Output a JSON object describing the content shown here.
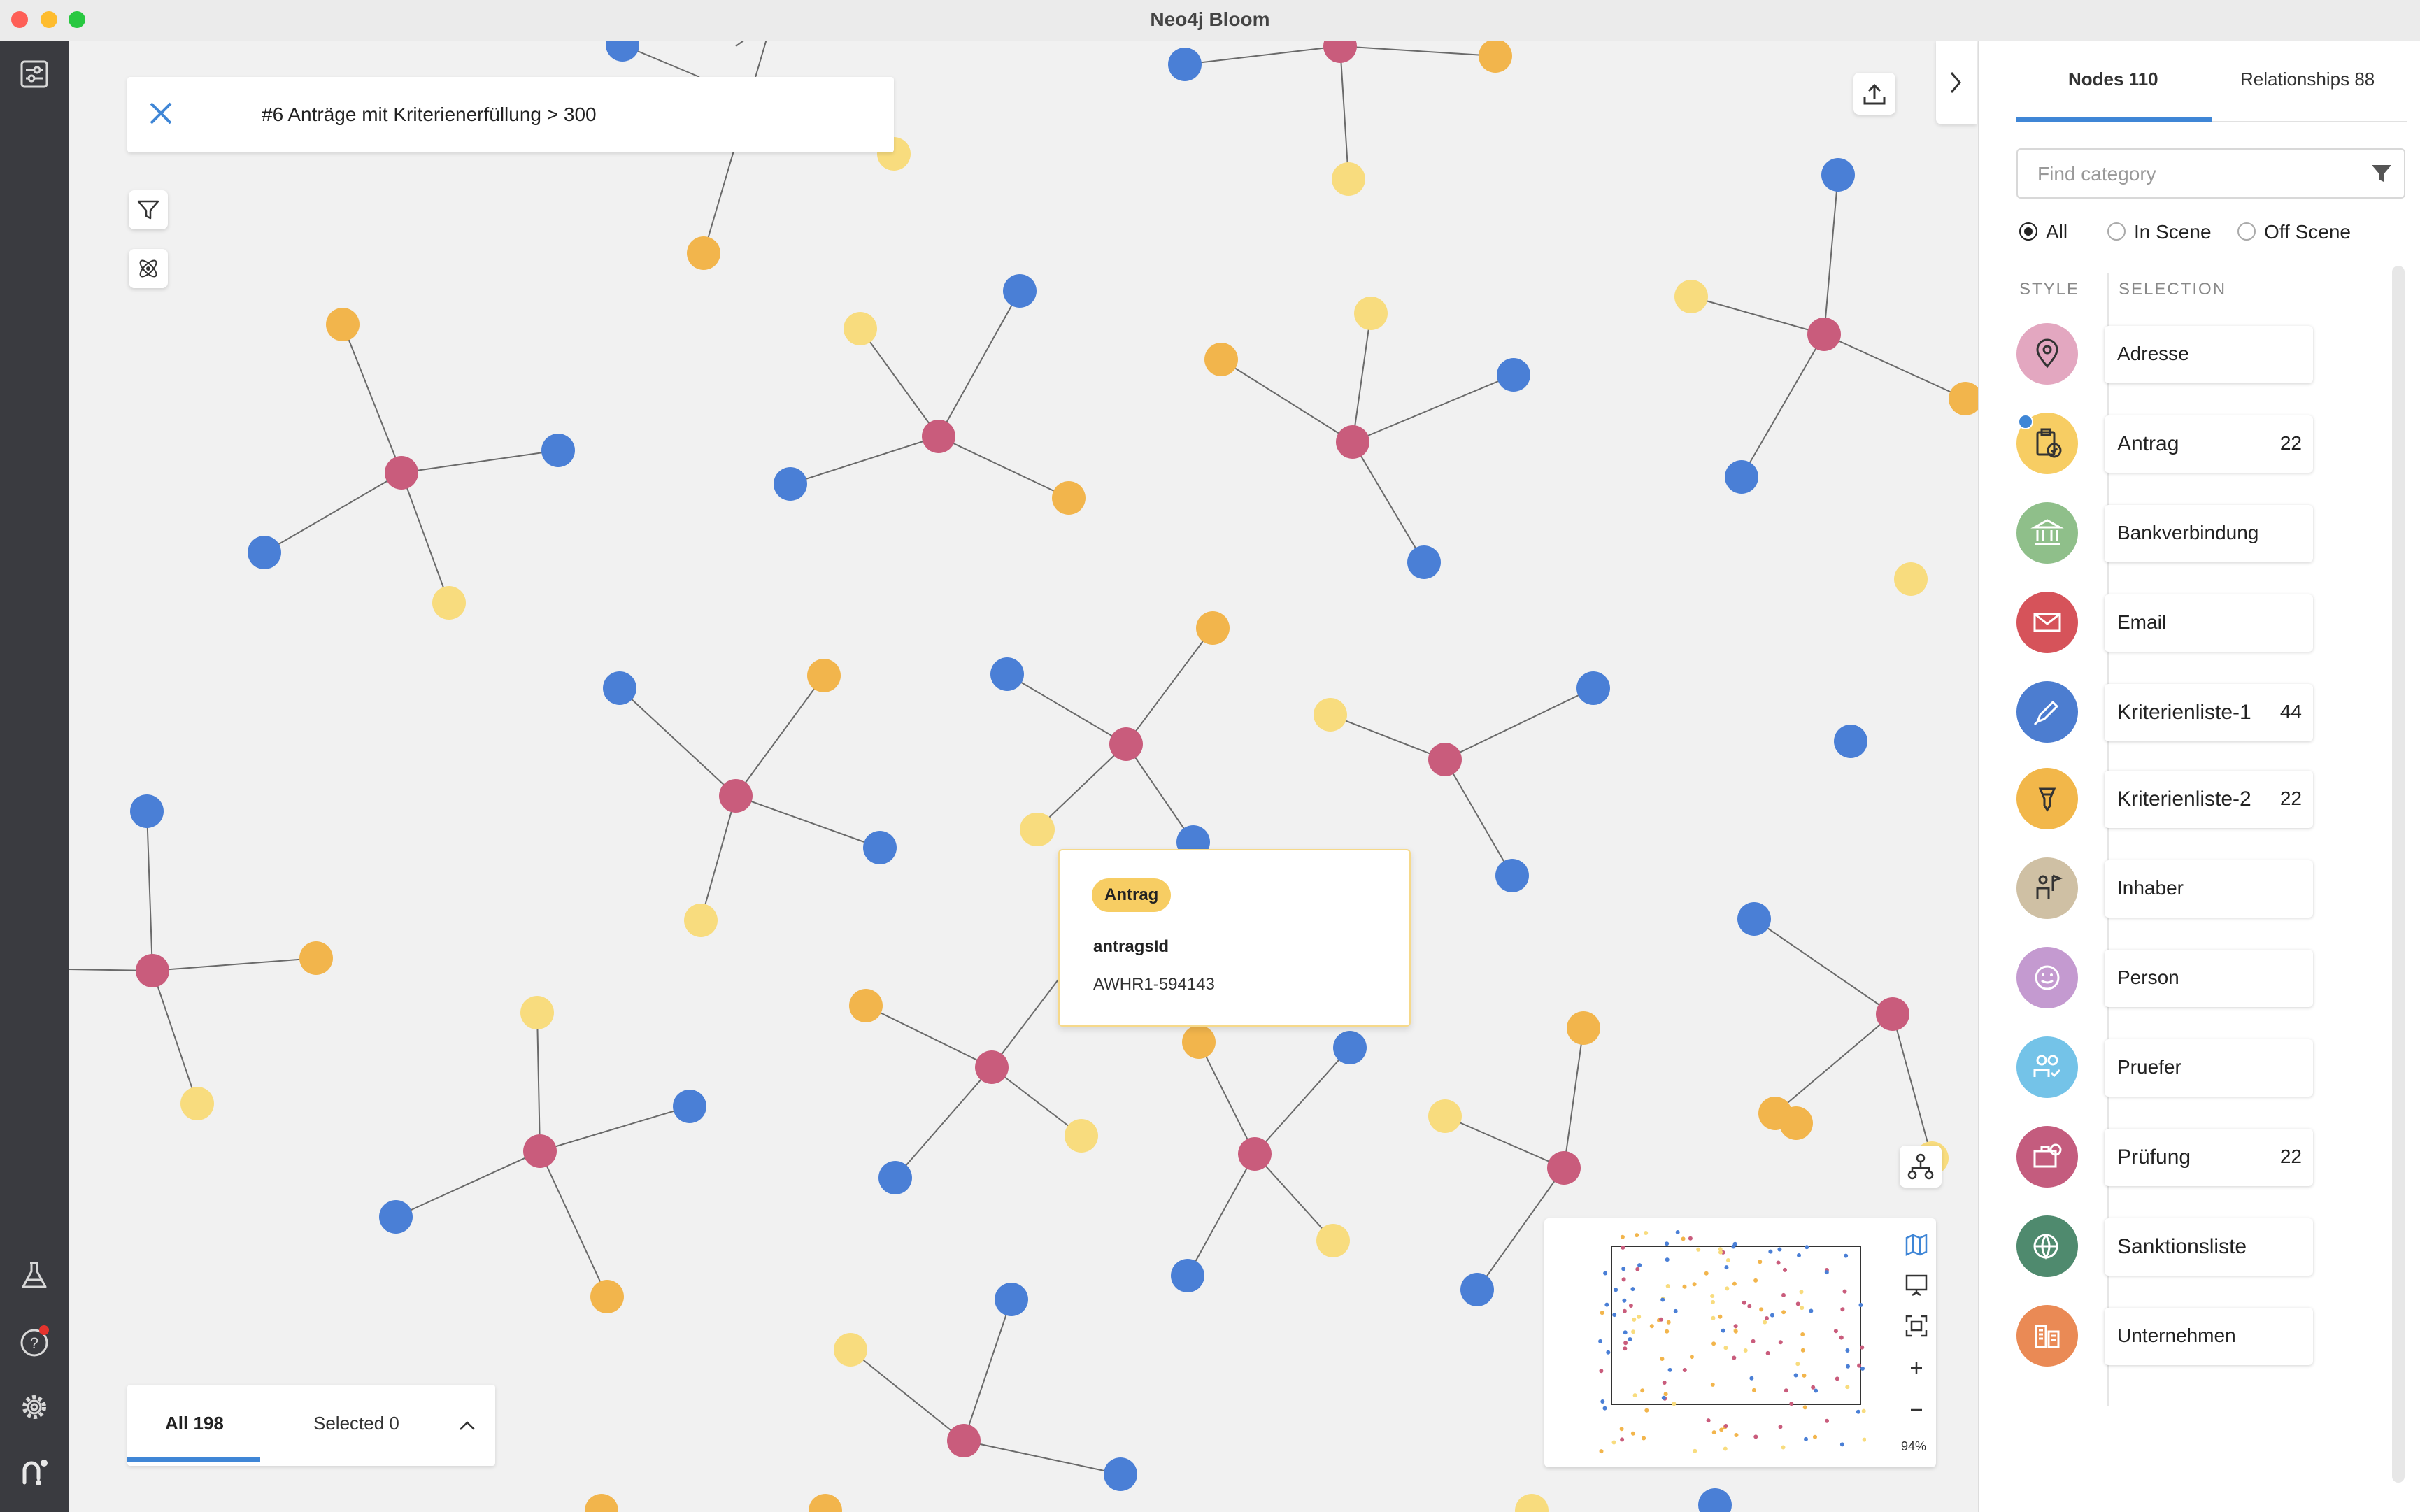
{
  "window": {
    "title": "Neo4j Bloom"
  },
  "search": {
    "query": "#6 Anträge mit Kriterienerfüllung > 300"
  },
  "popup": {
    "badge": "Antrag",
    "property_key": "antragsId",
    "property_value": "AWHR1-594143"
  },
  "countbar": {
    "all_label": "All 198",
    "selected_label": "Selected 0"
  },
  "minimap": {
    "zoom": "94%"
  },
  "panel": {
    "tabs": [
      {
        "label": "Nodes 110",
        "active": true
      },
      {
        "label": "Relationships 88",
        "active": false
      }
    ],
    "find_placeholder": "Find category",
    "filters": [
      {
        "label": "All",
        "checked": true
      },
      {
        "label": "In Scene",
        "checked": false
      },
      {
        "label": "Off Scene",
        "checked": false
      }
    ],
    "col_style": "STYLE",
    "col_selection": "SELECTION",
    "categories": [
      {
        "name": "Adresse",
        "count": "",
        "color": "#e3a7c0",
        "icon": "map-pin-icon"
      },
      {
        "name": "Antrag",
        "count": "22",
        "color": "#f7cd63",
        "icon": "clipboard-check-icon"
      },
      {
        "name": "Bankverbindung",
        "count": "",
        "color": "#8fbf8a",
        "icon": "bank-icon"
      },
      {
        "name": "Email",
        "count": "",
        "color": "#d6535a",
        "icon": "envelope-icon"
      },
      {
        "name": "Kriterienliste-1",
        "count": "44",
        "color": "#4c7dd0",
        "icon": "pen-icon"
      },
      {
        "name": "Kriterienliste-2",
        "count": "22",
        "color": "#f2b74a",
        "icon": "funnel-icon"
      },
      {
        "name": "Inhaber",
        "count": "",
        "color": "#cfc0a4",
        "icon": "person-flag-icon"
      },
      {
        "name": "Person",
        "count": "",
        "color": "#c49ad0",
        "icon": "face-icon"
      },
      {
        "name": "Pruefer",
        "count": "",
        "color": "#74c3e8",
        "icon": "people-check-icon"
      },
      {
        "name": "Prüfung",
        "count": "22",
        "color": "#c45c7e",
        "icon": "briefcase-check-icon"
      },
      {
        "name": "Sanktionsliste",
        "count": "",
        "color": "#4f8a6e",
        "icon": "globe-building-icon"
      },
      {
        "name": "Unternehmen",
        "count": "",
        "color": "#ea8a55",
        "icon": "buildings-icon"
      }
    ]
  },
  "graph_colors": {
    "antrag": "#c95c7c",
    "kriterienliste_1": "#4a7fd6",
    "kriterienliste_2": "#f2b54c",
    "pruefung": "#f8dc7e",
    "edge": "#6a6a6a"
  }
}
